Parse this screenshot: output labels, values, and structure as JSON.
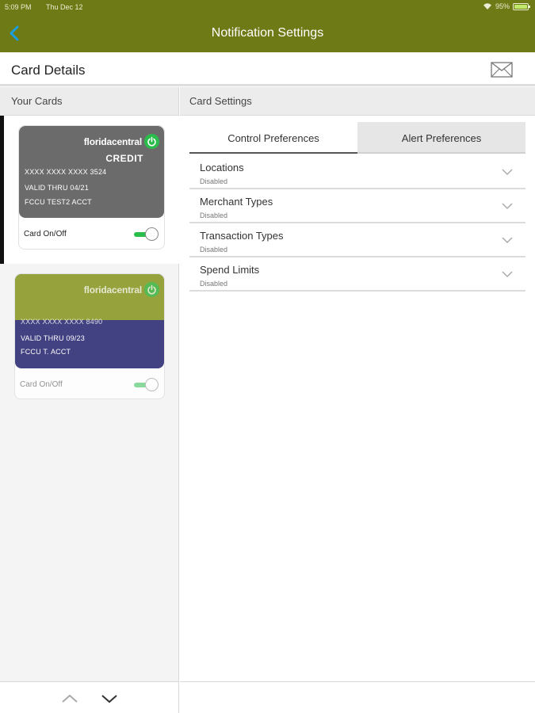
{
  "status_bar": {
    "time": "5:09 PM",
    "date": "Thu Dec 12",
    "battery": "95%"
  },
  "header": {
    "title": "Notification Settings"
  },
  "details": {
    "title": "Card Details"
  },
  "left": {
    "header": "Your Cards",
    "cards": [
      {
        "brand": "floridacentral",
        "type": "CREDIT",
        "number": "XXXX XXXX XXXX 3524",
        "valid": "VALID THRU 04/21",
        "name": "FCCU TEST2 ACCT",
        "toggle_label": "Card On/Off",
        "enabled": true,
        "selected": true,
        "color": "#6b6b6b"
      },
      {
        "brand": "floridacentral",
        "type": "",
        "number": "XXXX XXXX XXXX 8490",
        "valid": "VALID THRU 09/23",
        "name": "FCCU T. ACCT",
        "toggle_label": "Card On/Off",
        "enabled": true,
        "selected": false,
        "color_top": "#8c9b2a",
        "color_bottom": "#2f2f77"
      }
    ]
  },
  "right": {
    "header": "Card Settings",
    "tabs": [
      {
        "label": "Control Preferences",
        "active": true
      },
      {
        "label": "Alert Preferences",
        "active": false
      }
    ],
    "preferences": [
      {
        "title": "Locations",
        "status": "Disabled"
      },
      {
        "title": "Merchant Types",
        "status": "Disabled"
      },
      {
        "title": "Transaction Types",
        "status": "Disabled"
      },
      {
        "title": "Spend Limits",
        "status": "Disabled"
      }
    ]
  },
  "colors": {
    "header_bg": "#6e7a15",
    "accent": "#2bbd4c",
    "back_arrow": "#1a9fe0"
  }
}
